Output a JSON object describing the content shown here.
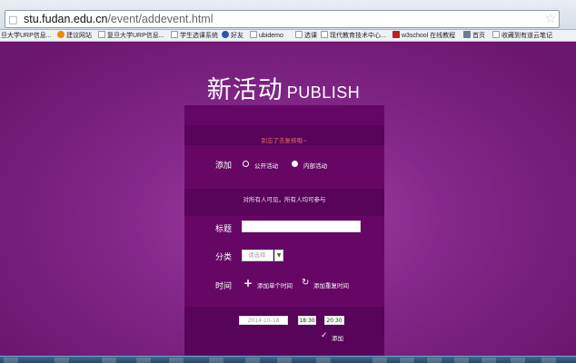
{
  "browser": {
    "url_host": "stu.fudan.edu.cn",
    "url_path": "/event/addevent.html",
    "bookmarks": [
      {
        "label": "旦大学URP信息...",
        "color": "#ffffff"
      },
      {
        "label": "建议网站",
        "color": "#f08a00"
      },
      {
        "label": "复旦大学URP信息...",
        "color": "#ffffff"
      },
      {
        "label": "学生选课系统",
        "color": "#ffffff"
      },
      {
        "label": "好友",
        "color": "#2a5aa8"
      },
      {
        "label": "ubidemo",
        "color": "#ffffff"
      },
      {
        "label": "选课",
        "color": "#ffffff"
      },
      {
        "label": "现代教育技术中心...",
        "color": "#ffffff"
      },
      {
        "label": "w3school 在线教程",
        "color": "#c0201e"
      },
      {
        "label": "首页",
        "color": "#6a7f90"
      },
      {
        "label": "收藏到有道云笔记",
        "color": "#ffffff"
      }
    ]
  },
  "page": {
    "title_cn": "新活动",
    "title_en": "PUBLISH",
    "warning": "别忘了去复核哦~",
    "add_label": "添加",
    "option_public": "公开活动",
    "option_internal": "内部活动",
    "visibility_note": "对所有人可见，所有人均可参与",
    "name_label": "标题",
    "name_value": "",
    "category_label": "分类",
    "category_placeholder": "请选择",
    "time_label": "时间",
    "add_single_time": "添加单个时间",
    "add_repeat_time": "添加重复时间",
    "date_value": "2014-10-18",
    "start_time": "18:30",
    "end_time": "20:30",
    "confirm_add": "添加"
  },
  "colors": {
    "accent": "#6a0f6c",
    "warning": "#e0705a"
  }
}
